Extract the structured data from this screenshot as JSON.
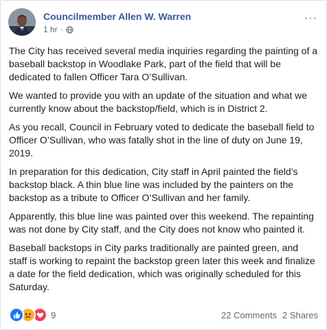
{
  "post": {
    "author": "Councilmember Allen W. Warren",
    "time": "1 hr",
    "separator": "·",
    "more_glyph": "···",
    "paragraphs": [
      "The City has received several media inquiries regarding the painting of a baseball backstop in Woodlake Park, part of the field that will be dedicated to fallen Officer Tara O’Sullivan.",
      "We wanted to provide you with an update of the situation and what we currently know about the backstop/field, which is in District 2.",
      "As you recall, Council in February voted to dedicate the baseball field to Officer O’Sullivan, who was fatally shot in the line of duty on June 19, 2019.",
      "In preparation for this dedication, City staff in April painted the field’s backstop black. A thin blue line was included by the painters on the backstop as a tribute to Officer O’Sullivan and her family.",
      "Apparently, this blue line was painted over this weekend. The repainting was not done by City staff, and the City does not know who painted it.",
      "Baseball backstops in City parks traditionally are painted green, and staff is working to repaint the backstop green later this week and finalize a date for the field dedication, which was originally scheduled for this Saturday."
    ]
  },
  "footer": {
    "reaction_count": "9",
    "reactions": [
      "like-icon",
      "sad-icon",
      "love-icon"
    ],
    "comments": "22 Comments",
    "shares": "2 Shares"
  },
  "colors": {
    "author_link": "#385898",
    "meta_text": "#606770",
    "like": "#1877f2",
    "sad": "#f7b125",
    "love": "#f33e58"
  }
}
